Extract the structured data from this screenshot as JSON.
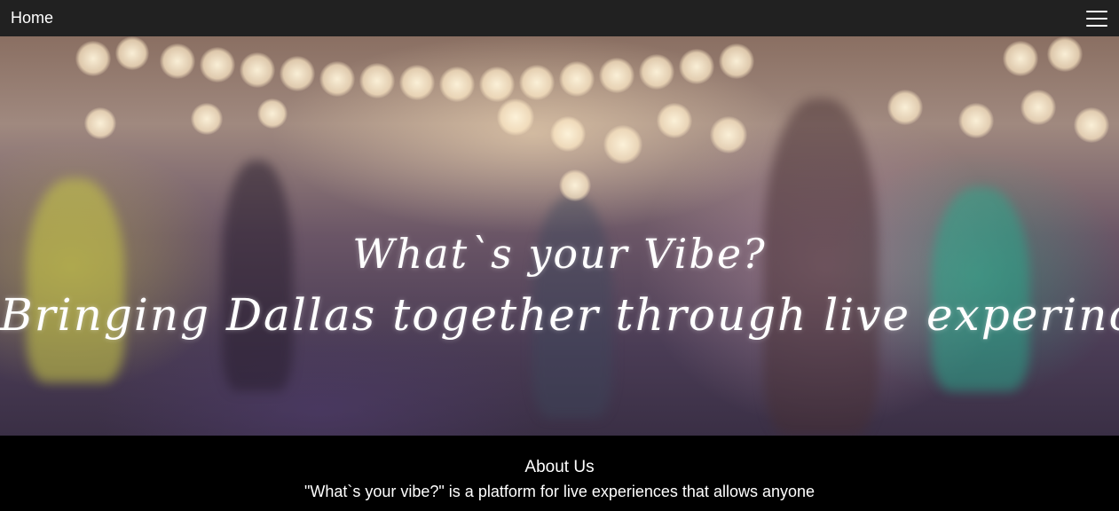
{
  "navbar": {
    "home_label": "Home",
    "menu_icon": "hamburger-menu-icon"
  },
  "hero": {
    "title": "What`s your Vibe?",
    "subtitle": "Bringing Dallas together through live experinces!!"
  },
  "about": {
    "heading": "About Us",
    "text": "\"What`s your vibe?\" is a platform for live experiences that allows anyone"
  }
}
